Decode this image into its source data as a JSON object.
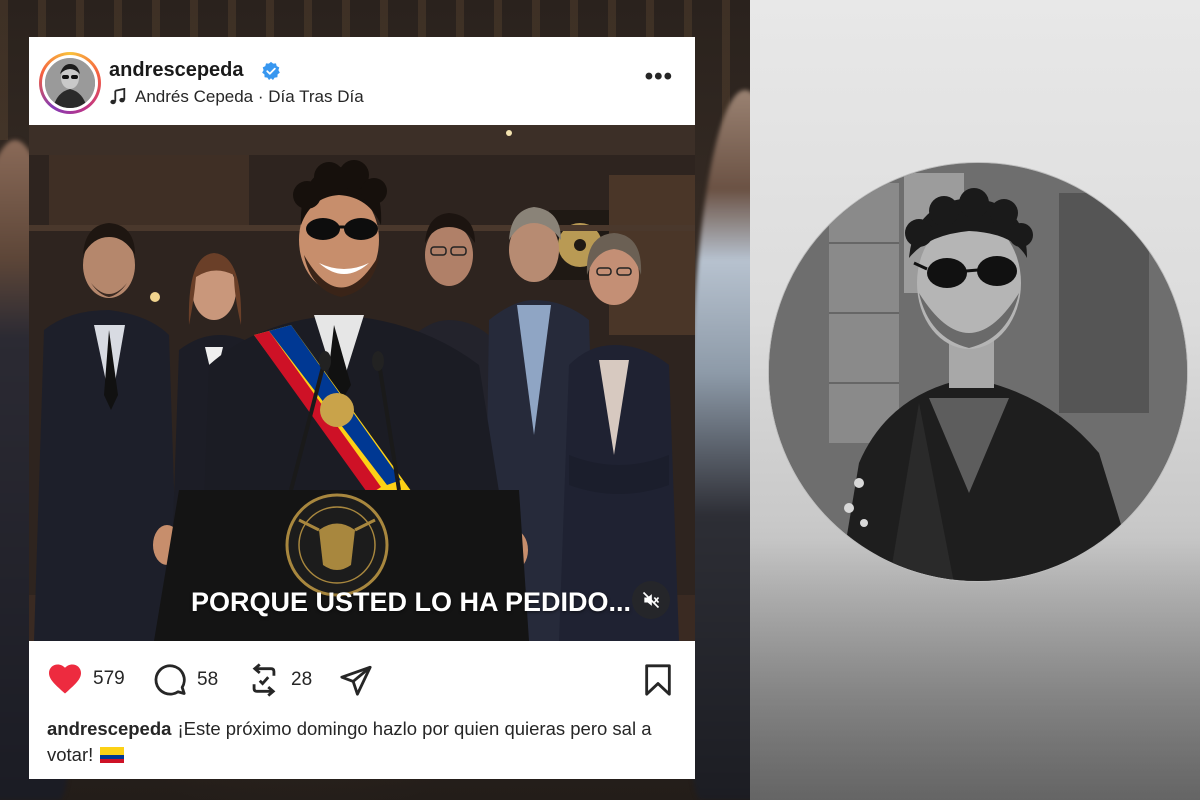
{
  "post": {
    "username": "andrescepeda",
    "verified": true,
    "music": "Andrés Cepeda · Día Tras Día",
    "more_label": "•••",
    "media_caption": "PORQUE USTED LO HA PEDIDO...",
    "likes": "579",
    "comments": "58",
    "reposts": "28",
    "caption_user": "andrescepeda",
    "caption_text": "¡Este próximo domingo hazlo por quien quieras pero sal a votar!",
    "caption_emoji": "colombia-flag"
  },
  "colors": {
    "like_red": "#ed2b3f",
    "verified_blue": "#3897f0",
    "card_bg": "#ffffff",
    "text_dark": "#262626"
  },
  "icons": [
    "music-note-icon",
    "verified-badge-icon",
    "more-icon",
    "mute-icon",
    "heart-icon",
    "comment-icon",
    "repost-icon",
    "share-icon",
    "bookmark-icon"
  ]
}
